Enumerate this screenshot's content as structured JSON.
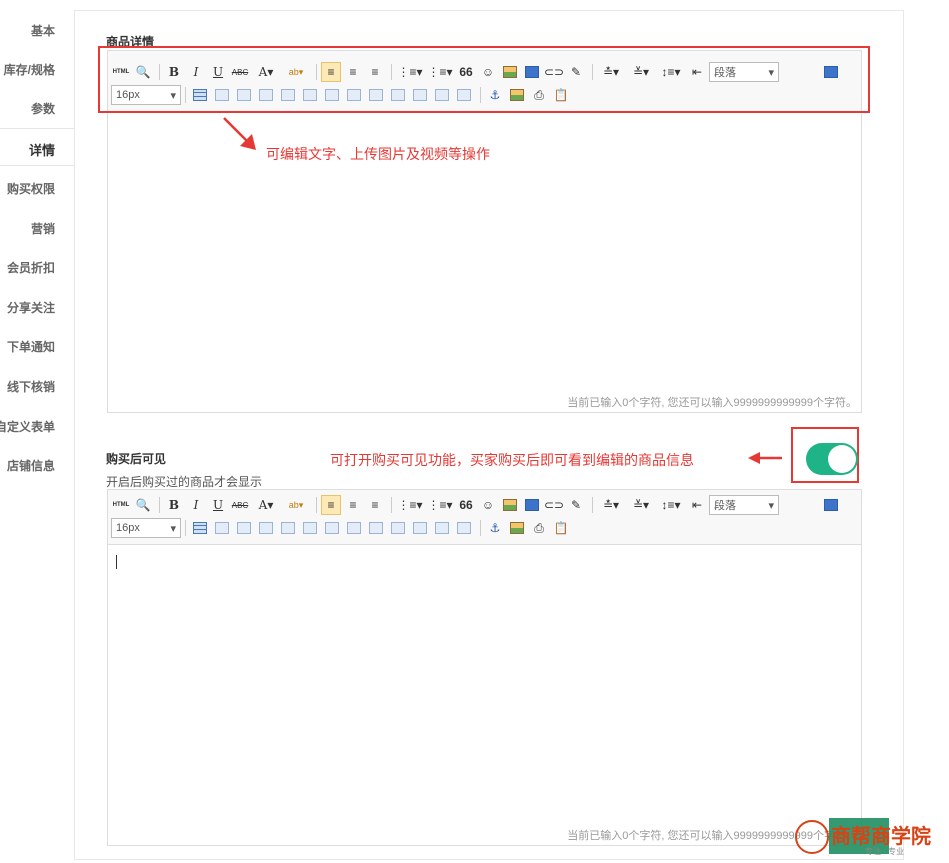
{
  "sidebar": {
    "items": [
      {
        "label": "基本"
      },
      {
        "label": "库存/规格"
      },
      {
        "label": "参数"
      },
      {
        "label": "详情"
      },
      {
        "label": "购买权限"
      },
      {
        "label": "营销"
      },
      {
        "label": "会员折扣"
      },
      {
        "label": "分享关注"
      },
      {
        "label": "下单通知"
      },
      {
        "label": "线下核销"
      },
      {
        "label": "自定义表单"
      },
      {
        "label": "店铺信息"
      }
    ]
  },
  "detail": {
    "title": "商品详情",
    "annotation": "可编辑文字、上传图片及视频等操作",
    "counter": "当前已输入0个字符, 您还可以输入9999999999999个字符。"
  },
  "after_purchase": {
    "title": "购买后可见",
    "subtitle": "开启后购买过的商品才会显示",
    "annotation": "可打开购买可见功能，买家购买后即可看到编辑的商品信息",
    "toggle_on": true,
    "counter": "当前已输入0个字符, 您还可以输入9999999999999个字符。"
  },
  "toolbar": {
    "html": "HTML",
    "bold": "B",
    "italic": "I",
    "underline": "U",
    "strike": "ABC",
    "fontcolor": "A",
    "bgcolor": "ab",
    "quote": "66",
    "paragraph": "段落",
    "fontsize": "16px"
  },
  "colors": {
    "accent": "#1fb388",
    "annotation": "#e53935"
  },
  "watermark": {
    "text": "商帮商学院",
    "sub": "专注 · 专业"
  }
}
